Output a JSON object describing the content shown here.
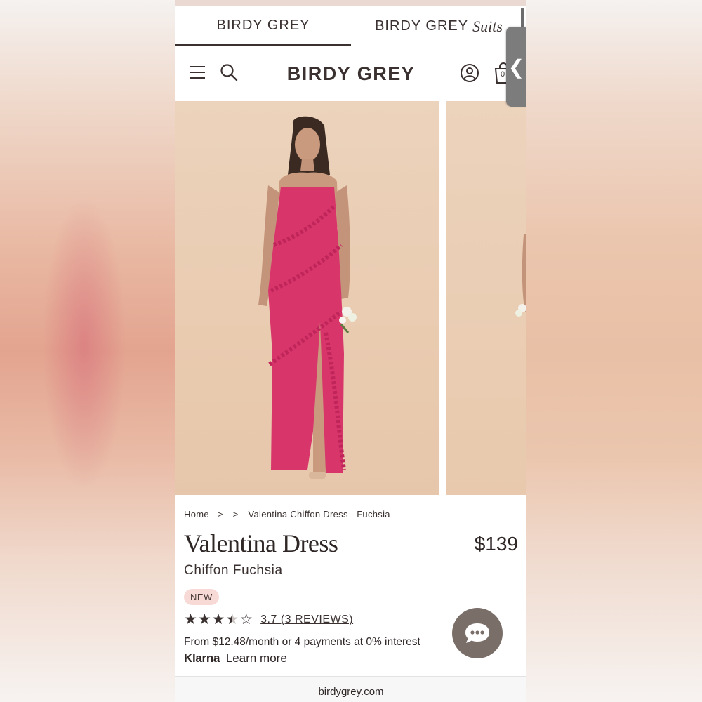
{
  "brand_tabs": [
    {
      "label": "BIRDY GREY",
      "suffix": ""
    },
    {
      "label": "BIRDY GREY",
      "suffix": "Suits"
    }
  ],
  "header": {
    "logo": "BIRDY GREY",
    "cart_count": "0"
  },
  "breadcrumb": {
    "home": "Home",
    "sep1": ">",
    "sep2": ">",
    "current": "Valentina Chiffon Dress - Fuchsia"
  },
  "product": {
    "title": "Valentina Dress",
    "price": "$139",
    "subtitle": "Chiffon Fuchsia",
    "badge": "NEW",
    "rating": 3.7,
    "rating_text": "3.7 (3 REVIEWS)"
  },
  "payments": {
    "text": "From $12.48/month or 4 payments at 0% interest",
    "klarna": "Klarna",
    "learn_more": "Learn more"
  },
  "browser": {
    "url": "birdygrey.com"
  },
  "colors": {
    "brand_text": "#3a3130",
    "dress": "#d8366b",
    "backdrop": "#ecd3bc",
    "badge_bg": "#f7dad6",
    "chat_button": "#7a6e69"
  }
}
